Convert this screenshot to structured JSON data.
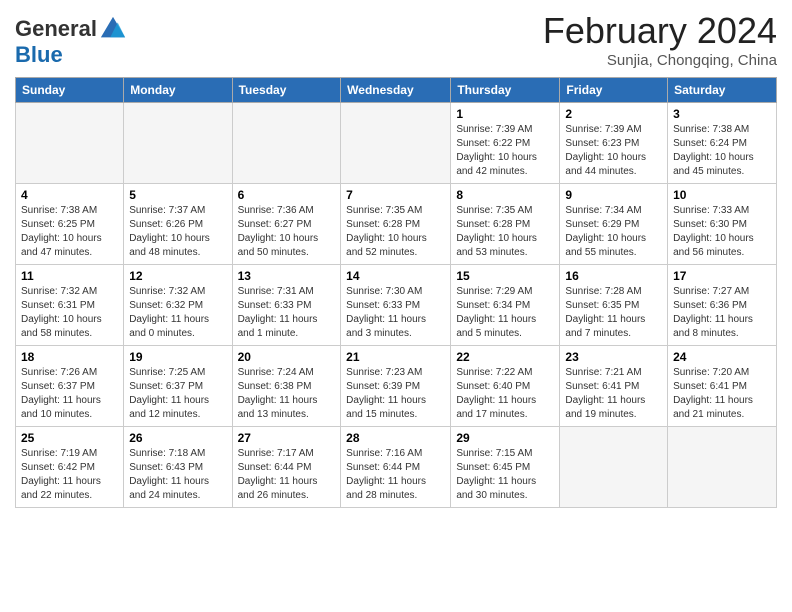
{
  "logo": {
    "general": "General",
    "blue": "Blue"
  },
  "header": {
    "month": "February 2024",
    "location": "Sunjia, Chongqing, China"
  },
  "weekdays": [
    "Sunday",
    "Monday",
    "Tuesday",
    "Wednesday",
    "Thursday",
    "Friday",
    "Saturday"
  ],
  "weeks": [
    [
      {
        "day": "",
        "info": ""
      },
      {
        "day": "",
        "info": ""
      },
      {
        "day": "",
        "info": ""
      },
      {
        "day": "",
        "info": ""
      },
      {
        "day": "1",
        "info": "Sunrise: 7:39 AM\nSunset: 6:22 PM\nDaylight: 10 hours\nand 42 minutes."
      },
      {
        "day": "2",
        "info": "Sunrise: 7:39 AM\nSunset: 6:23 PM\nDaylight: 10 hours\nand 44 minutes."
      },
      {
        "day": "3",
        "info": "Sunrise: 7:38 AM\nSunset: 6:24 PM\nDaylight: 10 hours\nand 45 minutes."
      }
    ],
    [
      {
        "day": "4",
        "info": "Sunrise: 7:38 AM\nSunset: 6:25 PM\nDaylight: 10 hours\nand 47 minutes."
      },
      {
        "day": "5",
        "info": "Sunrise: 7:37 AM\nSunset: 6:26 PM\nDaylight: 10 hours\nand 48 minutes."
      },
      {
        "day": "6",
        "info": "Sunrise: 7:36 AM\nSunset: 6:27 PM\nDaylight: 10 hours\nand 50 minutes."
      },
      {
        "day": "7",
        "info": "Sunrise: 7:35 AM\nSunset: 6:28 PM\nDaylight: 10 hours\nand 52 minutes."
      },
      {
        "day": "8",
        "info": "Sunrise: 7:35 AM\nSunset: 6:28 PM\nDaylight: 10 hours\nand 53 minutes."
      },
      {
        "day": "9",
        "info": "Sunrise: 7:34 AM\nSunset: 6:29 PM\nDaylight: 10 hours\nand 55 minutes."
      },
      {
        "day": "10",
        "info": "Sunrise: 7:33 AM\nSunset: 6:30 PM\nDaylight: 10 hours\nand 56 minutes."
      }
    ],
    [
      {
        "day": "11",
        "info": "Sunrise: 7:32 AM\nSunset: 6:31 PM\nDaylight: 10 hours\nand 58 minutes."
      },
      {
        "day": "12",
        "info": "Sunrise: 7:32 AM\nSunset: 6:32 PM\nDaylight: 11 hours\nand 0 minutes."
      },
      {
        "day": "13",
        "info": "Sunrise: 7:31 AM\nSunset: 6:33 PM\nDaylight: 11 hours\nand 1 minute."
      },
      {
        "day": "14",
        "info": "Sunrise: 7:30 AM\nSunset: 6:33 PM\nDaylight: 11 hours\nand 3 minutes."
      },
      {
        "day": "15",
        "info": "Sunrise: 7:29 AM\nSunset: 6:34 PM\nDaylight: 11 hours\nand 5 minutes."
      },
      {
        "day": "16",
        "info": "Sunrise: 7:28 AM\nSunset: 6:35 PM\nDaylight: 11 hours\nand 7 minutes."
      },
      {
        "day": "17",
        "info": "Sunrise: 7:27 AM\nSunset: 6:36 PM\nDaylight: 11 hours\nand 8 minutes."
      }
    ],
    [
      {
        "day": "18",
        "info": "Sunrise: 7:26 AM\nSunset: 6:37 PM\nDaylight: 11 hours\nand 10 minutes."
      },
      {
        "day": "19",
        "info": "Sunrise: 7:25 AM\nSunset: 6:37 PM\nDaylight: 11 hours\nand 12 minutes."
      },
      {
        "day": "20",
        "info": "Sunrise: 7:24 AM\nSunset: 6:38 PM\nDaylight: 11 hours\nand 13 minutes."
      },
      {
        "day": "21",
        "info": "Sunrise: 7:23 AM\nSunset: 6:39 PM\nDaylight: 11 hours\nand 15 minutes."
      },
      {
        "day": "22",
        "info": "Sunrise: 7:22 AM\nSunset: 6:40 PM\nDaylight: 11 hours\nand 17 minutes."
      },
      {
        "day": "23",
        "info": "Sunrise: 7:21 AM\nSunset: 6:41 PM\nDaylight: 11 hours\nand 19 minutes."
      },
      {
        "day": "24",
        "info": "Sunrise: 7:20 AM\nSunset: 6:41 PM\nDaylight: 11 hours\nand 21 minutes."
      }
    ],
    [
      {
        "day": "25",
        "info": "Sunrise: 7:19 AM\nSunset: 6:42 PM\nDaylight: 11 hours\nand 22 minutes."
      },
      {
        "day": "26",
        "info": "Sunrise: 7:18 AM\nSunset: 6:43 PM\nDaylight: 11 hours\nand 24 minutes."
      },
      {
        "day": "27",
        "info": "Sunrise: 7:17 AM\nSunset: 6:44 PM\nDaylight: 11 hours\nand 26 minutes."
      },
      {
        "day": "28",
        "info": "Sunrise: 7:16 AM\nSunset: 6:44 PM\nDaylight: 11 hours\nand 28 minutes."
      },
      {
        "day": "29",
        "info": "Sunrise: 7:15 AM\nSunset: 6:45 PM\nDaylight: 11 hours\nand 30 minutes."
      },
      {
        "day": "",
        "info": ""
      },
      {
        "day": "",
        "info": ""
      }
    ]
  ]
}
